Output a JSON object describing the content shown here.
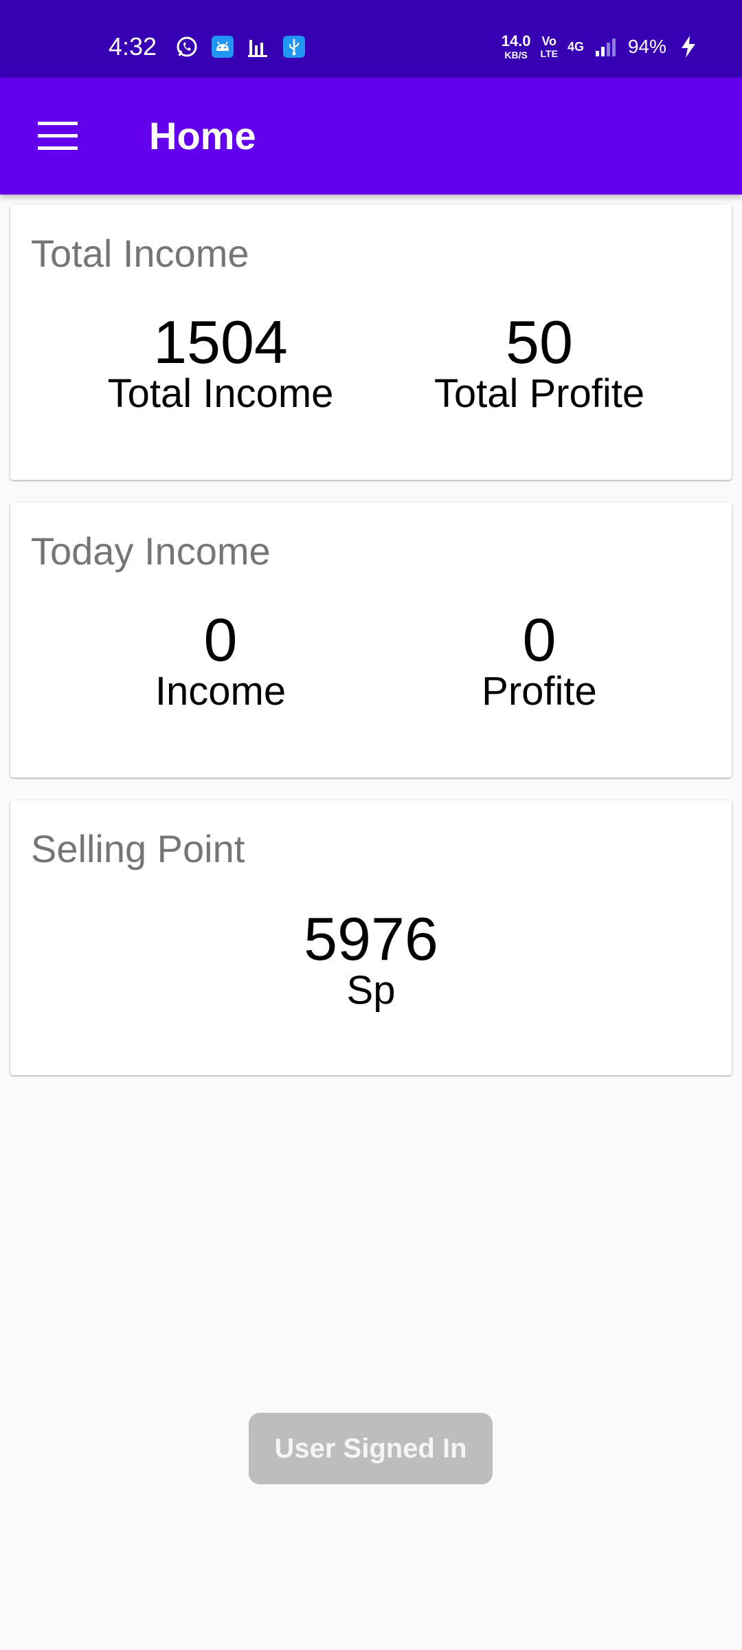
{
  "status_bar": {
    "time": "4:32",
    "icons_left": [
      "whatsapp-icon",
      "android-icon",
      "bar-chart-icon",
      "usb-icon"
    ],
    "net_speed_value": "14.0",
    "net_speed_unit": "KB/S",
    "volte_top": "Vo",
    "volte_bottom": "LTE",
    "network_type": "4G",
    "battery_percent": "94%"
  },
  "app_bar": {
    "title": "Home",
    "menu_icon": "hamburger-menu-icon",
    "background": "#6200ee"
  },
  "cards": [
    {
      "title": "Total Income",
      "stats": [
        {
          "value": "1504",
          "label": "Total Income"
        },
        {
          "value": "50",
          "label": "Total Profite"
        }
      ]
    },
    {
      "title": "Today Income",
      "stats": [
        {
          "value": "0",
          "label": "Income"
        },
        {
          "value": "0",
          "label": "Profite"
        }
      ]
    },
    {
      "title": "Selling Point",
      "stats": [
        {
          "value": "5976",
          "label": "Sp"
        }
      ]
    }
  ],
  "footer_button": {
    "label": "User Signed In",
    "enabled": false
  },
  "colors": {
    "status_bar": "#3700b3",
    "app_bar": "#6200ee",
    "card_title": "#757575",
    "button_disabled": "#bdbdbd"
  }
}
